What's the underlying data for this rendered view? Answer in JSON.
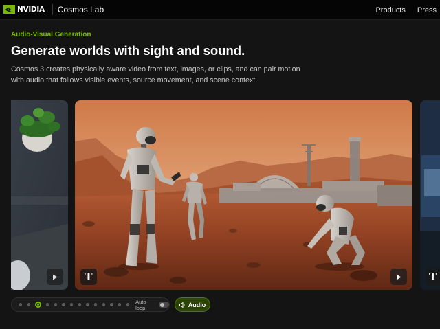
{
  "header": {
    "brand": "NVIDIA",
    "product": "Cosmos Lab",
    "nav": [
      {
        "label": "Products"
      },
      {
        "label": "Press"
      }
    ]
  },
  "hero": {
    "eyebrow": "Audio-Visual Generation",
    "title": "Generate worlds with sight and sound.",
    "description": "Cosmos 3 creates physically aware video from text, images, or clips, and can pair motion with audio that follows visible events, source movement, and scene context."
  },
  "carousel": {
    "slide_count": 14,
    "active_index": 2,
    "text_button_label": "T",
    "autoloop_label": "Auto-loop",
    "autoloop_on": false,
    "audio_button_label": "Audio"
  },
  "colors": {
    "accent": "#76b900",
    "background": "#141414",
    "topbar": "#050505"
  }
}
